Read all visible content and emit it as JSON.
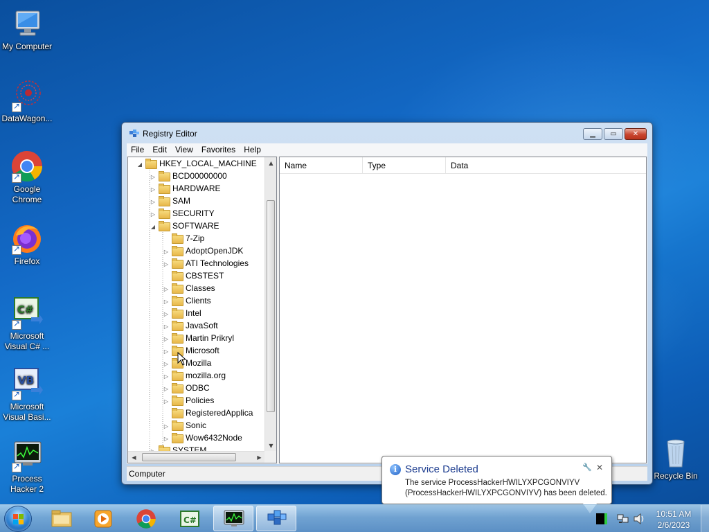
{
  "desktop": {
    "icons": [
      {
        "label": "My Computer",
        "icon": "computer-icon"
      },
      {
        "label": "DataWagon...",
        "icon": "datawagon-icon"
      },
      {
        "label": "Google Chrome",
        "icon": "chrome-icon"
      },
      {
        "label": "Firefox",
        "icon": "firefox-icon"
      },
      {
        "label": "Microsoft Visual C# ...",
        "icon": "visual-csharp-icon"
      },
      {
        "label": "Microsoft Visual Basi...",
        "icon": "visual-basic-icon"
      },
      {
        "label": "Process Hacker 2",
        "icon": "process-hacker-icon"
      },
      {
        "label": "Recycle Bin",
        "icon": "recycle-bin-icon"
      }
    ]
  },
  "window": {
    "title": "Registry Editor",
    "controls": [
      "minimize",
      "maximize",
      "close"
    ]
  },
  "menu": [
    "File",
    "Edit",
    "View",
    "Favorites",
    "Help"
  ],
  "tree": {
    "root": "HKEY_LOCAL_MACHINE",
    "hklm_children": [
      "BCD00000000",
      "HARDWARE",
      "SAM",
      "SECURITY",
      "SOFTWARE"
    ],
    "software_children": [
      "7-Zip",
      "AdoptOpenJDK",
      "ATI Technologies",
      "CBSTEST",
      "Classes",
      "Clients",
      "Intel",
      "JavaSoft",
      "Martin Prikryl",
      "Microsoft",
      "Mozilla",
      "mozilla.org",
      "ODBC",
      "Policies",
      "RegisteredApplica",
      "Sonic",
      "Wow6432Node"
    ],
    "next_partial": "SYSTEM"
  },
  "list": {
    "columns": [
      "Name",
      "Type",
      "Data"
    ]
  },
  "status": "Computer",
  "notification": {
    "title": "Service Deleted",
    "body": "The service ProcessHackerHWILYXPCGONVIYV (ProcessHackerHWILYXPCGONVIYV) has been deleted."
  },
  "taskbar": {
    "time": "10:51 AM",
    "date": "2/6/2023"
  }
}
